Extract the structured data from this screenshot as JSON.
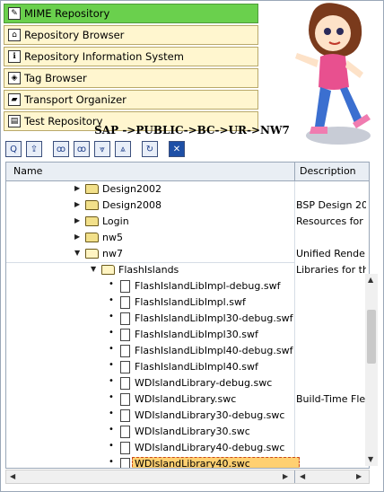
{
  "nav": [
    {
      "label": "MIME Repository",
      "icon": "mime-repository-icon",
      "glyph": "✎",
      "active": true
    },
    {
      "label": "Repository Browser",
      "icon": "repository-browser-icon",
      "glyph": "⌂",
      "active": false
    },
    {
      "label": "Repository Information System",
      "icon": "information-system-icon",
      "glyph": "ℹ",
      "active": false
    },
    {
      "label": "Tag Browser",
      "icon": "tag-browser-icon",
      "glyph": "◈",
      "active": false
    },
    {
      "label": "Transport Organizer",
      "icon": "truck-icon",
      "glyph": "▰",
      "active": false
    },
    {
      "label": "Test Repository",
      "icon": "test-repository-icon",
      "glyph": "▤",
      "active": false
    }
  ],
  "path": "SAP ->PUBLIC->BC->UR->NW7",
  "toolbar": {
    "buttons": [
      "find-icon",
      "import-icon",
      "binoculars-icon",
      "binoculars-next-icon",
      "expand-icon",
      "collapse-icon",
      "refresh-icon",
      "close-icon"
    ]
  },
  "tree": {
    "col_name": "Name",
    "col_desc": "Description",
    "rows": [
      {
        "type": "folder",
        "indent": 1,
        "expander": "▶",
        "name": "Design2002",
        "desc": ""
      },
      {
        "type": "folder",
        "indent": 1,
        "expander": "▶",
        "name": "Design2008",
        "desc": "BSP Design 20"
      },
      {
        "type": "folder",
        "indent": 1,
        "expander": "▶",
        "name": "Login",
        "desc": "Resources for"
      },
      {
        "type": "folder",
        "indent": 1,
        "expander": "▶",
        "name": "nw5",
        "desc": ""
      },
      {
        "type": "folder",
        "indent": 1,
        "expander": "▼",
        "name": "nw7",
        "desc": "Unified Rende"
      },
      {
        "type": "folder",
        "indent": 2,
        "expander": "▼",
        "name": "FlashIslands",
        "desc": "Libraries for th"
      },
      {
        "type": "file",
        "indent": 3,
        "name": "FlashIslandLibImpl-debug.swf",
        "desc": ""
      },
      {
        "type": "file",
        "indent": 3,
        "name": "FlashIslandLibImpl.swf",
        "desc": ""
      },
      {
        "type": "file",
        "indent": 3,
        "name": "FlashIslandLibImpl30-debug.swf",
        "desc": ""
      },
      {
        "type": "file",
        "indent": 3,
        "name": "FlashIslandLibImpl30.swf",
        "desc": ""
      },
      {
        "type": "file",
        "indent": 3,
        "name": "FlashIslandLibImpl40-debug.swf",
        "desc": ""
      },
      {
        "type": "file",
        "indent": 3,
        "name": "FlashIslandLibImpl40.swf",
        "desc": ""
      },
      {
        "type": "file",
        "indent": 3,
        "name": "WDIslandLibrary-debug.swc",
        "desc": ""
      },
      {
        "type": "file",
        "indent": 3,
        "name": "WDIslandLibrary.swc",
        "desc": "Build-Time Flex"
      },
      {
        "type": "file",
        "indent": 3,
        "name": "WDIslandLibrary30-debug.swc",
        "desc": ""
      },
      {
        "type": "file",
        "indent": 3,
        "name": "WDIslandLibrary30.swc",
        "desc": ""
      },
      {
        "type": "file",
        "indent": 3,
        "name": "WDIslandLibrary40-debug.swc",
        "desc": ""
      },
      {
        "type": "file",
        "indent": 3,
        "name": "WDIslandLibrary40.swc",
        "desc": "",
        "selected": true
      }
    ]
  }
}
